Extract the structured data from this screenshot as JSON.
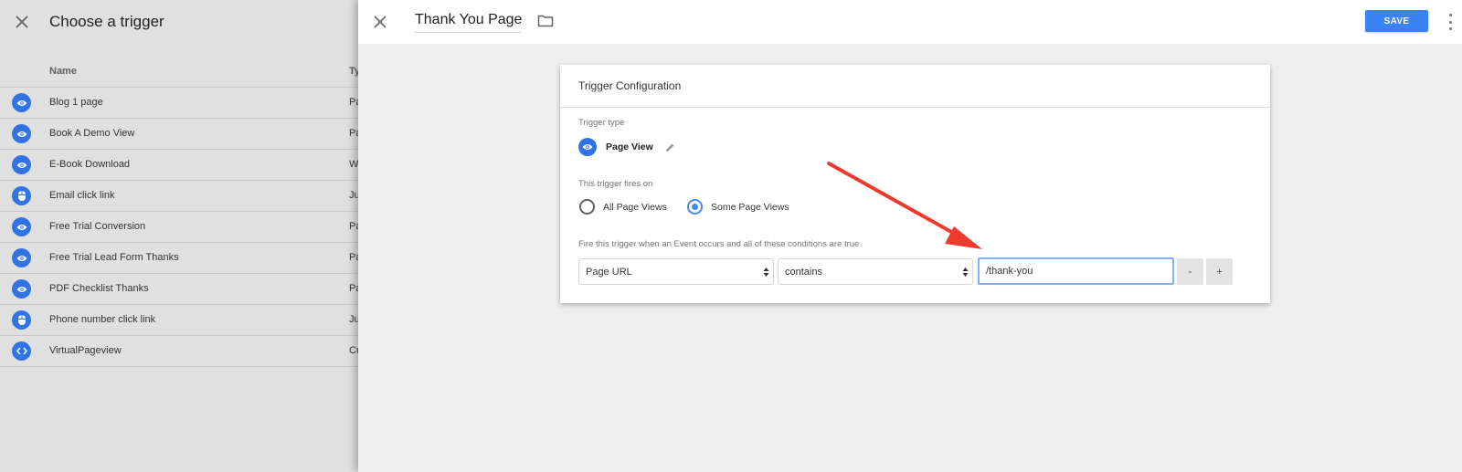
{
  "left_panel": {
    "title": "Choose a trigger",
    "columns": {
      "name": "Name",
      "type": "Ty"
    },
    "triggers": [
      {
        "name": "Blog 1 page",
        "type": "Pa",
        "icon": "eye-icon"
      },
      {
        "name": "Book A Demo View",
        "type": "Pa",
        "icon": "eye-icon"
      },
      {
        "name": "E-Book Download",
        "type": "W",
        "icon": "eye-icon"
      },
      {
        "name": "Email click link",
        "type": "Ju",
        "icon": "mouse-icon"
      },
      {
        "name": "Free Trial Conversion",
        "type": "Pa",
        "icon": "eye-icon"
      },
      {
        "name": "Free Trial Lead Form Thanks",
        "type": "Pa",
        "icon": "eye-icon"
      },
      {
        "name": "PDF Checklist Thanks",
        "type": "Pa",
        "icon": "eye-icon"
      },
      {
        "name": "Phone number click link",
        "type": "Ju",
        "icon": "mouse-icon"
      },
      {
        "name": "VirtualPageview",
        "type": "Cu",
        "icon": "code-icon"
      }
    ]
  },
  "editor": {
    "title": "Thank You Page",
    "save_label": "SAVE",
    "card": {
      "heading": "Trigger Configuration",
      "trigger_type_label": "Trigger type",
      "trigger_type_value": "Page View",
      "fires_on_label": "This trigger fires on",
      "fires_on_options": [
        "All Page Views",
        "Some Page Views"
      ],
      "fires_on_selected": "Some Page Views",
      "condition_label": "Fire this trigger when an Event occurs and all of these conditions are true",
      "condition": {
        "variable": "Page URL",
        "operator": "contains",
        "value": "/thank-you"
      },
      "remove_label": "-",
      "add_label": "+"
    }
  },
  "colors": {
    "accent": "#3b82f6",
    "icon_blue": "#2f73e4",
    "annotation_arrow": "#f03a2e"
  }
}
